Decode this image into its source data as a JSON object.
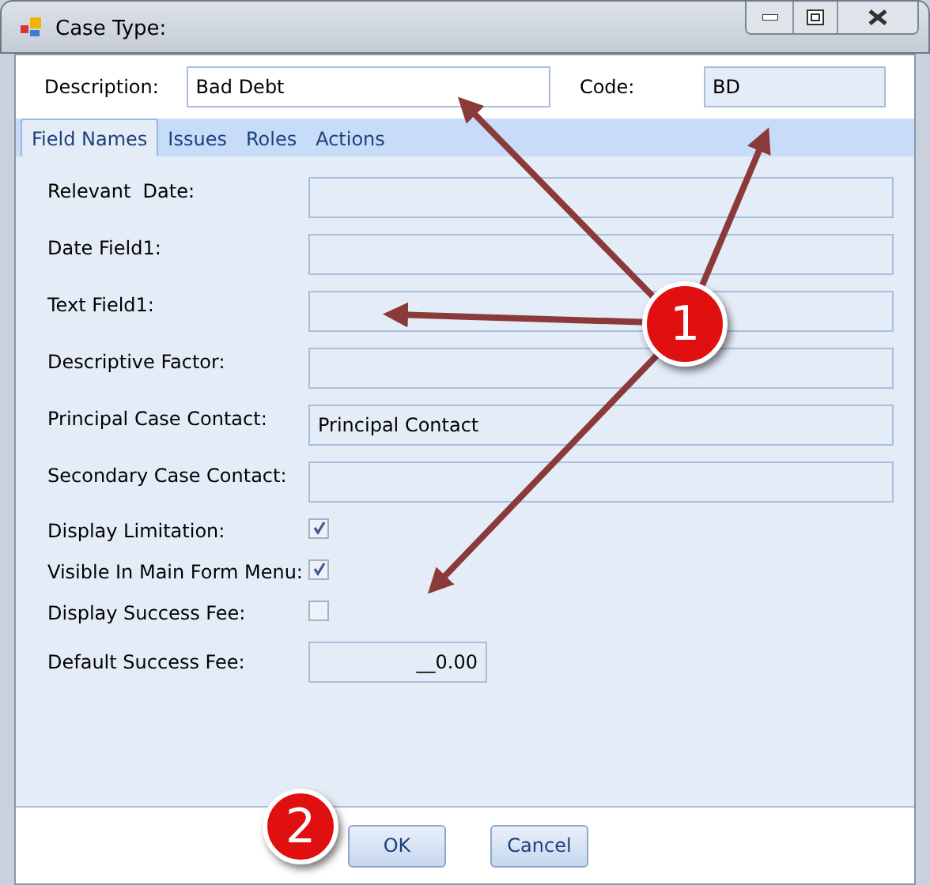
{
  "window": {
    "title": "Case Type:"
  },
  "description": {
    "label": "Description:",
    "value": "Bad Debt",
    "disabled": false
  },
  "code": {
    "label": "Code:",
    "value": "BD",
    "disabled": true
  },
  "tabs": [
    {
      "label": "Field Names",
      "selected": true
    },
    {
      "label": "Issues",
      "selected": false
    },
    {
      "label": "Roles",
      "selected": false
    },
    {
      "label": "Actions",
      "selected": false
    }
  ],
  "fields": [
    {
      "kind": "text",
      "label": "Relevant  Date:"
    },
    {
      "kind": "text",
      "label": "Date Field1:"
    },
    {
      "kind": "text",
      "label": "Text Field1:"
    },
    {
      "kind": "text",
      "label": "Descriptive Factor:"
    },
    {
      "kind": "text",
      "label": "Principal Case Contact:",
      "value": "Principal Contact"
    },
    {
      "kind": "text",
      "label": "Secondary Case Contact:"
    },
    {
      "kind": "checkbox",
      "label": "Display Limitation:",
      "checked": true
    },
    {
      "kind": "checkbox",
      "label": "Visible In Main Form Menu:",
      "checked": true
    },
    {
      "kind": "checkbox",
      "label": "Display Success Fee:",
      "checked": false
    },
    {
      "kind": "number",
      "label": "Default Success Fee:",
      "value": "__0.00"
    }
  ],
  "buttons": [
    "OK",
    "Cancel"
  ],
  "callouts": [
    "1",
    "2"
  ]
}
